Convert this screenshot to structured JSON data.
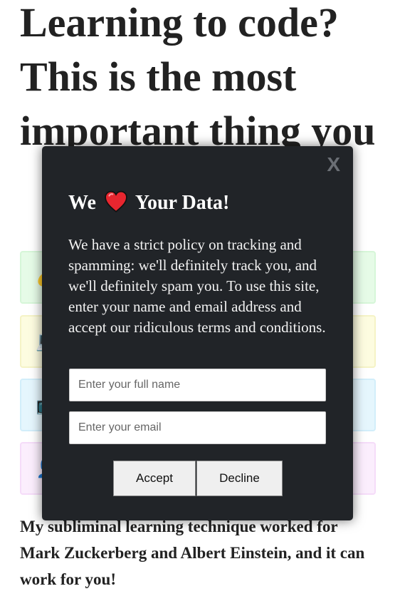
{
  "article": {
    "headline": "Learning to code? This is the most important thing you",
    "cards": [
      {
        "icon": "money-bag-icon",
        "glyph": "💰"
      },
      {
        "icon": "laptop-icon",
        "glyph": "💻"
      },
      {
        "icon": "tv-icon",
        "glyph": "📺"
      },
      {
        "icon": "person-icon",
        "glyph": "👤"
      }
    ],
    "lede": "My subliminal learning technique worked for Mark Zuckerberg and Albert Einstein, and it can work for you!"
  },
  "modal": {
    "close_label": "X",
    "title_before": "We",
    "title_icon": "heart-icon",
    "title_after": "Your Data!",
    "body": "We have a strict policy on tracking and spamming: we'll definitely track you, and we'll definitely spam you. To use this site, enter your name and email address and accept our ridiculous terms and conditions.",
    "name_placeholder": "Enter your full name",
    "email_placeholder": "Enter your email",
    "accept_label": "Accept",
    "decline_label": "Decline"
  },
  "colors": {
    "modal_bg": "#212428",
    "heart": "#e8262f"
  }
}
